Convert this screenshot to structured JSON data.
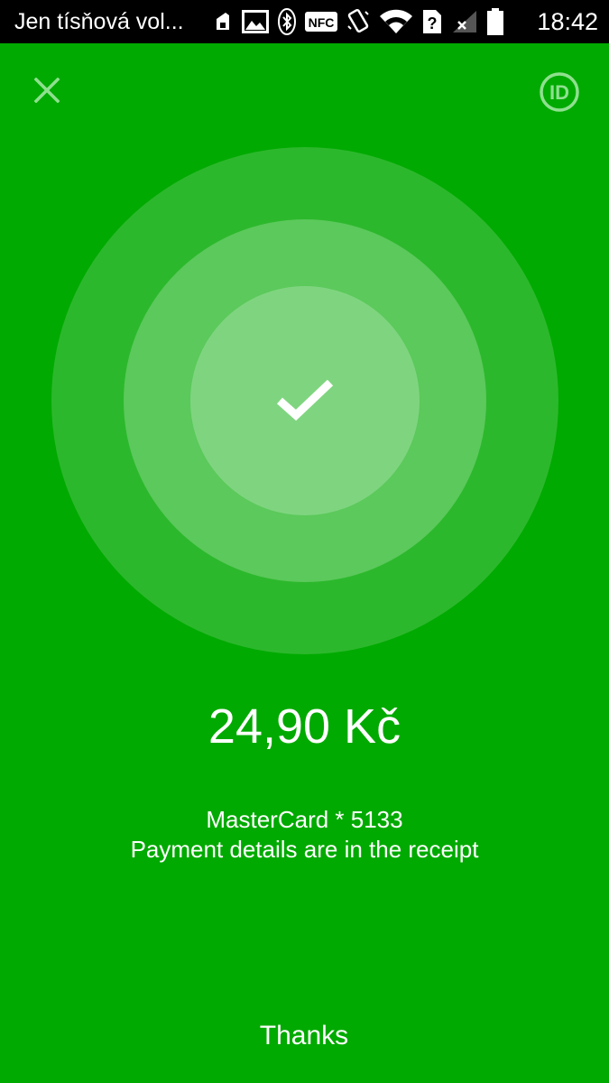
{
  "status_bar": {
    "carrier_text": "Jen tísňová vol...",
    "nfc_label": "NFC",
    "time": "18:42",
    "icons": [
      "notification-icon",
      "image-icon",
      "bluetooth-icon",
      "nfc-icon",
      "vibrate-icon",
      "wifi-icon",
      "sim-unknown-icon",
      "signal-off-icon",
      "battery-icon"
    ]
  },
  "header": {
    "close_icon": "close-icon",
    "id_label": "ID"
  },
  "result": {
    "icon": "check-icon",
    "amount": "24,90 Kč",
    "card": "MasterCard * 5133",
    "details": "Payment details are in the receipt"
  },
  "footer": {
    "thanks_label": "Thanks"
  },
  "colors": {
    "background": "#00aa00",
    "ring_outer": "#2cb82c",
    "ring_middle": "#5bc95b",
    "ring_inner": "#7fd57f",
    "accent_icon": "#8fe08f",
    "text": "#ffffff"
  }
}
